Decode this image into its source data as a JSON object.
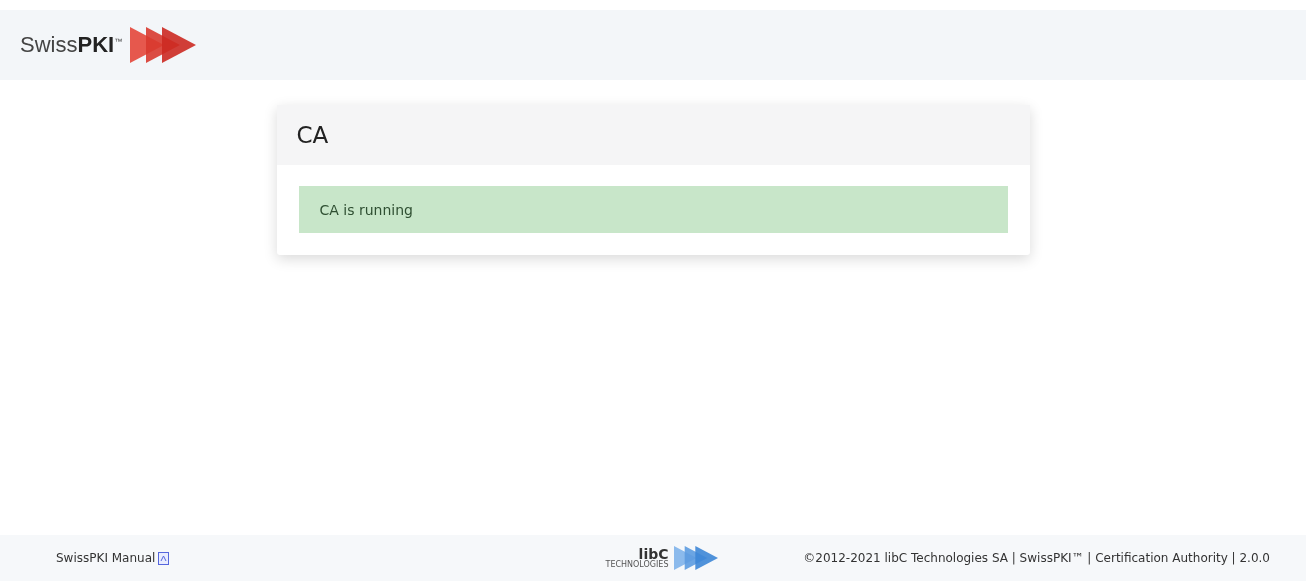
{
  "header": {
    "logo_text": "Swiss**PKI**$^{™}$"
  },
  "card": {
    "title": "CA",
    "alert": {
      "kind": "success",
      "text": "CA is running"
    }
  },
  "footer": {
    "manual_link": "SwissPKI Manual",
    "company_logo": {
      "name": "libC",
      "subtitle": "TECHNOLOGIES"
    },
    "copyright": "©2012-2021 libC Technologies SA | SwissPKI™ | Certification Authority | 2.0.0"
  }
}
